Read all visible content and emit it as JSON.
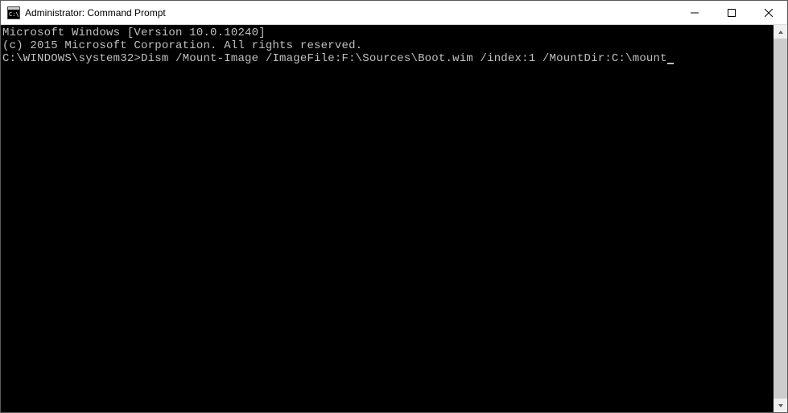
{
  "window": {
    "title": "Administrator: Command Prompt"
  },
  "terminal": {
    "line1": "Microsoft Windows [Version 10.0.10240]",
    "line2": "(c) 2015 Microsoft Corporation. All rights reserved.",
    "blank": "",
    "prompt": "C:\\WINDOWS\\system32>",
    "command": "Dism /Mount-Image /ImageFile:F:\\Sources\\Boot.wim /index:1 /MountDir:C:\\mount"
  }
}
